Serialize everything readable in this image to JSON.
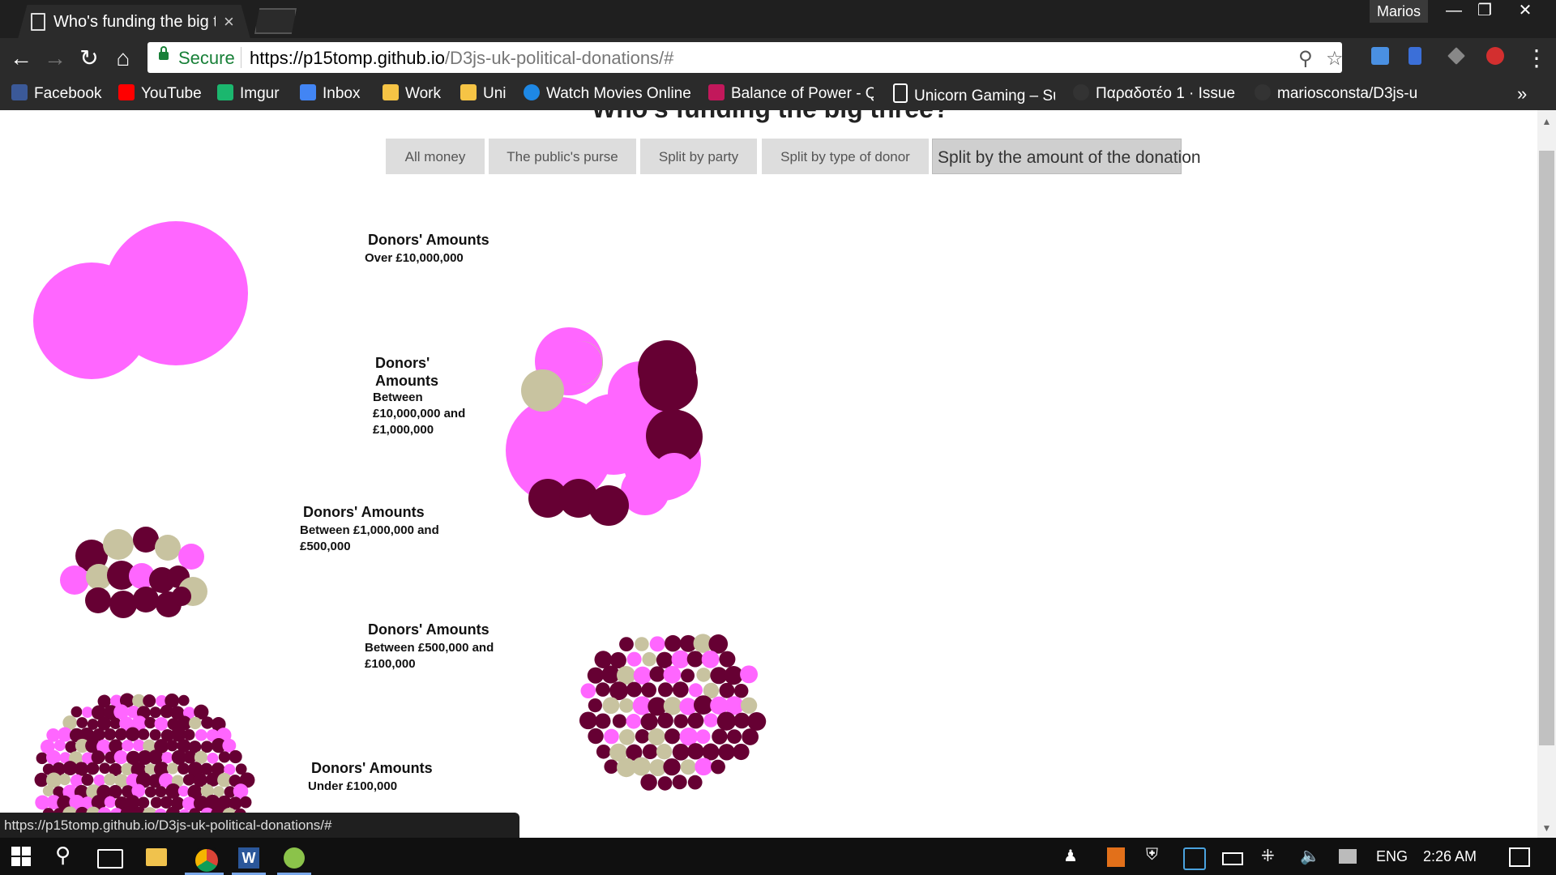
{
  "browser": {
    "tab_title": "Who's funding the big three?",
    "tab_close": "×",
    "user_name": "Marios",
    "url_host": "https://p15tomp.github.io",
    "url_path": "/D3js-uk-political-donations/#",
    "secure_label": "Secure",
    "status_url": "https://p15tomp.github.io/D3js-uk-political-donations/#",
    "more_bookmarks": "»"
  },
  "bookmarks": [
    {
      "label": "Facebook",
      "color": "#3b5998"
    },
    {
      "label": "YouTube",
      "color": "#ff0000"
    },
    {
      "label": "Imgur",
      "color": "#1bb76e"
    },
    {
      "label": "Inbox",
      "color": "#4285f4"
    },
    {
      "label": "Work",
      "color": "#f6c445"
    },
    {
      "label": "Uni",
      "color": "#f6c445"
    },
    {
      "label": "Watch Movies Online",
      "color": "#1e88e5"
    },
    {
      "label": "Balance of Power - Q",
      "color": "#c2185b"
    },
    {
      "label": "Unicorn Gaming – Su",
      "color": "#ffffff"
    },
    {
      "label": "Παραδοτέο 1 · Issue",
      "color": "#333333"
    },
    {
      "label": "mariosconsta/D3js-u",
      "color": "#333333"
    }
  ],
  "page": {
    "heading": "Who's funding the big three?",
    "buttons": [
      {
        "label": "All money",
        "active": false
      },
      {
        "label": "The public's purse",
        "active": false
      },
      {
        "label": "Split by party",
        "active": false
      },
      {
        "label": "Split by type of donor",
        "active": false
      },
      {
        "label": "Split by the amount of the donation",
        "active": true
      }
    ],
    "groups": [
      {
        "title": "Donors' Amounts",
        "subtitle": "Over £10,000,000"
      },
      {
        "title": "Donors' Amounts",
        "subtitle": "Between £10,000,000 and £1,000,000"
      },
      {
        "title": "Donors' Amounts",
        "subtitle": "Between £1,000,000 and £500,000"
      },
      {
        "title": "Donors' Amounts",
        "subtitle": "Between £500,000 and £100,000"
      },
      {
        "title": "Donors' Amounts",
        "subtitle": "Under £100,000"
      }
    ],
    "colors": {
      "pink": "#ff66ff",
      "maroon": "#660033",
      "beige": "#c8c3a0"
    }
  },
  "taskbar": {
    "language": "ENG",
    "time": "2:26 AM"
  }
}
